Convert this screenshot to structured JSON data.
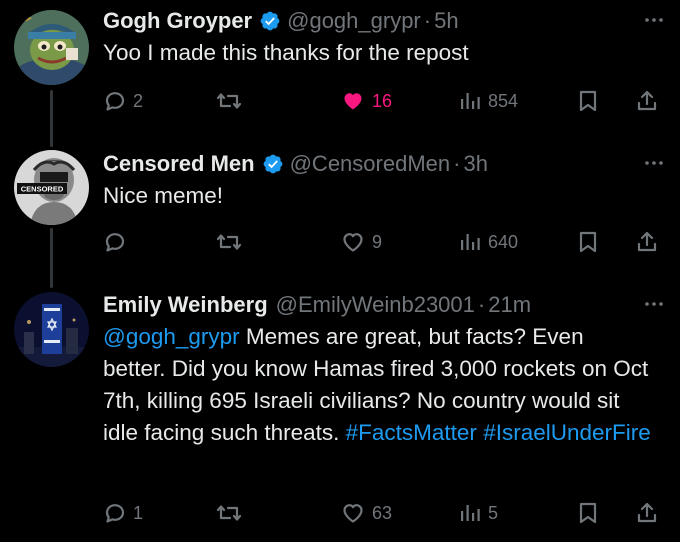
{
  "colors": {
    "background": "#000000",
    "text_primary": "#e7e9ea",
    "text_secondary": "#71767b",
    "link": "#1d9bf0",
    "verified": "#1d9bf0",
    "like_active": "#f91880",
    "thread_line": "#333639"
  },
  "tweets": [
    {
      "display_name": "Gogh Groyper",
      "verified": true,
      "handle": "@gogh_grypr",
      "separator": "·",
      "time": "5h",
      "text": "Yoo I made this thanks for the repost",
      "avatar_icon": "van-gogh-frog-avatar",
      "reply_count": "2",
      "retweet_count": "",
      "like_count": "16",
      "liked": true,
      "view_count": "854"
    },
    {
      "display_name": "Censored Men",
      "verified": true,
      "handle": "@CensoredMen",
      "separator": "·",
      "time": "3h",
      "text": "Nice meme!",
      "avatar_icon": "censored-bust-avatar",
      "avatar_label": "CENSORED",
      "reply_count": "",
      "retweet_count": "",
      "like_count": "9",
      "liked": false,
      "view_count": "640"
    },
    {
      "display_name": "Emily Weinberg",
      "verified": false,
      "handle": "@EmilyWeinb23001",
      "separator": "·",
      "time": "21m",
      "mention": "@gogh_grypr",
      "text": " Memes are great, but facts? Even better. Did you know Hamas fired 3,000 rockets on Oct 7th, killing 695 Israeli civilians? No country would sit idle facing such threats. ",
      "hashtags": [
        "#FactsMatter",
        "#IsraelUnderFire"
      ],
      "avatar_icon": "city-building-flag-avatar",
      "reply_count": "1",
      "retweet_count": "",
      "like_count": "63",
      "liked": false,
      "view_count": "5"
    }
  ],
  "icons": {
    "reply": "reply-icon",
    "retweet": "retweet-icon",
    "like": "heart-icon",
    "views": "views-icon",
    "bookmark": "bookmark-icon",
    "share": "share-icon",
    "more": "more-icon",
    "verified": "verified-badge-icon"
  }
}
